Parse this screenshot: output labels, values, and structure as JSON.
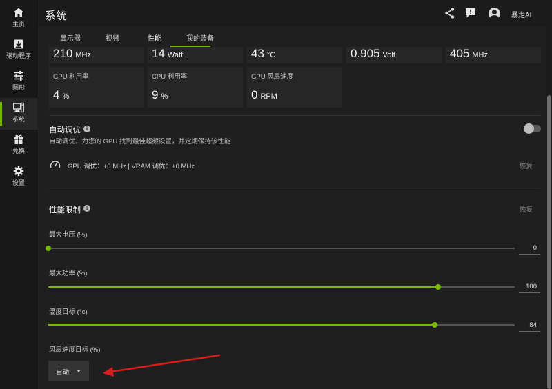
{
  "sidebar": {
    "items": [
      {
        "label": "主页",
        "icon": "home-icon"
      },
      {
        "label": "驱动程序",
        "icon": "download-icon"
      },
      {
        "label": "图形",
        "icon": "sliders-icon"
      },
      {
        "label": "系统",
        "icon": "monitor-icon",
        "active": true
      },
      {
        "label": "兑换",
        "icon": "gift-icon"
      },
      {
        "label": "设置",
        "icon": "gear-icon"
      }
    ]
  },
  "header": {
    "title": "系统",
    "username": "暴走AI"
  },
  "tabs": [
    {
      "label": "显示器"
    },
    {
      "label": "视频"
    },
    {
      "label": "性能",
      "active": true
    },
    {
      "label": "我的装备"
    }
  ],
  "metrics_top": [
    {
      "value": "210",
      "unit": "MHz"
    },
    {
      "value": "14",
      "unit": "Watt"
    },
    {
      "value": "43",
      "unit": "°C"
    },
    {
      "value": "0.905",
      "unit": "Volt"
    },
    {
      "value": "405",
      "unit": "MHz"
    }
  ],
  "metrics": [
    {
      "label": "GPU 利用率",
      "value": "4",
      "unit": "%"
    },
    {
      "label": "CPU 利用率",
      "value": "9",
      "unit": "%"
    },
    {
      "label": "GPU 风扇速度",
      "value": "0",
      "unit": "RPM"
    }
  ],
  "auto_tune": {
    "title": "自动调优",
    "description": "自动调优，为您的 GPU 找到最佳超频设置，并定期保持该性能",
    "enabled": false,
    "status": "GPU 调优：+0 MHz   |   VRAM 调优：+0 MHz",
    "restore_label": "恢复"
  },
  "perf_limits": {
    "title": "性能限制",
    "restore_label": "恢复",
    "sliders": [
      {
        "label": "最大电压 (%)",
        "value": "0",
        "fraction": 0.0
      },
      {
        "label": "最大功率 (%)",
        "value": "100",
        "fraction": 0.836
      },
      {
        "label": "温度目标 (°c)",
        "value": "84",
        "fraction": 0.828
      }
    ],
    "fan_target": {
      "label": "风扇速度目标 (%)",
      "selected": "自动"
    }
  },
  "colors": {
    "accent": "#76b900",
    "annotation_arrow": "#d91c1c"
  }
}
